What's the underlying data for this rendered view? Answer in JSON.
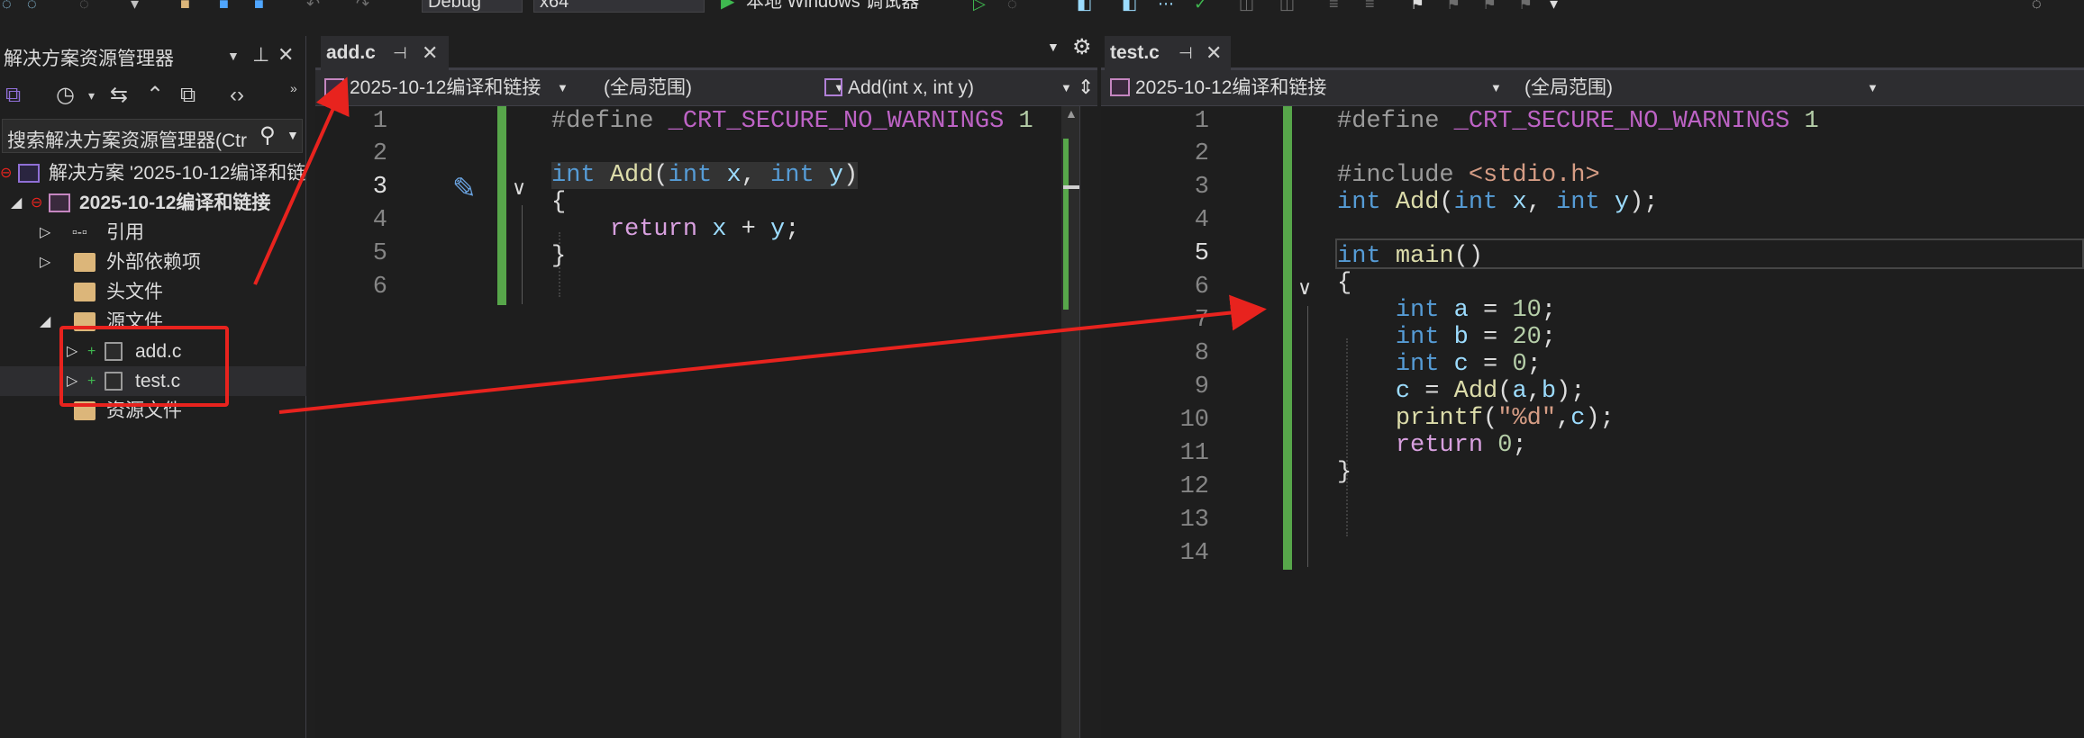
{
  "toolbar": {
    "config": "Debug",
    "platform": "x64",
    "run_label": "本地 Windows 调试器"
  },
  "explorer": {
    "title": "解决方案资源管理器",
    "search_placeholder": "搜索解决方案资源管理器(Ctr",
    "solution_label": "解决方案 '2025-10-12编译和链",
    "project_label": "2025-10-12编译和链接",
    "items": [
      {
        "label": "引用"
      },
      {
        "label": "外部依赖项"
      },
      {
        "label": "头文件"
      },
      {
        "label": "源文件"
      },
      {
        "label": "add.c"
      },
      {
        "label": "test.c"
      },
      {
        "label": "资源文件"
      }
    ]
  },
  "left_editor": {
    "tab": "add.c",
    "nav_project": "2025-10-12编译和链接",
    "nav_scope": "(全局范围)",
    "nav_member": "Add(int x, int y)",
    "line_numbers": [
      "1",
      "2",
      "3",
      "4",
      "5",
      "6"
    ]
  },
  "right_editor": {
    "tab": "test.c",
    "nav_project": "2025-10-12编译和链接",
    "nav_scope": "(全局范围)",
    "line_numbers": [
      "1",
      "2",
      "3",
      "4",
      "5",
      "6",
      "7",
      "8",
      "9",
      "10",
      "11",
      "12",
      "13",
      "14"
    ]
  },
  "colors": {
    "accent_red": "#e8231e",
    "change_bar": "#57a64a",
    "keyword": "#569cd6"
  }
}
